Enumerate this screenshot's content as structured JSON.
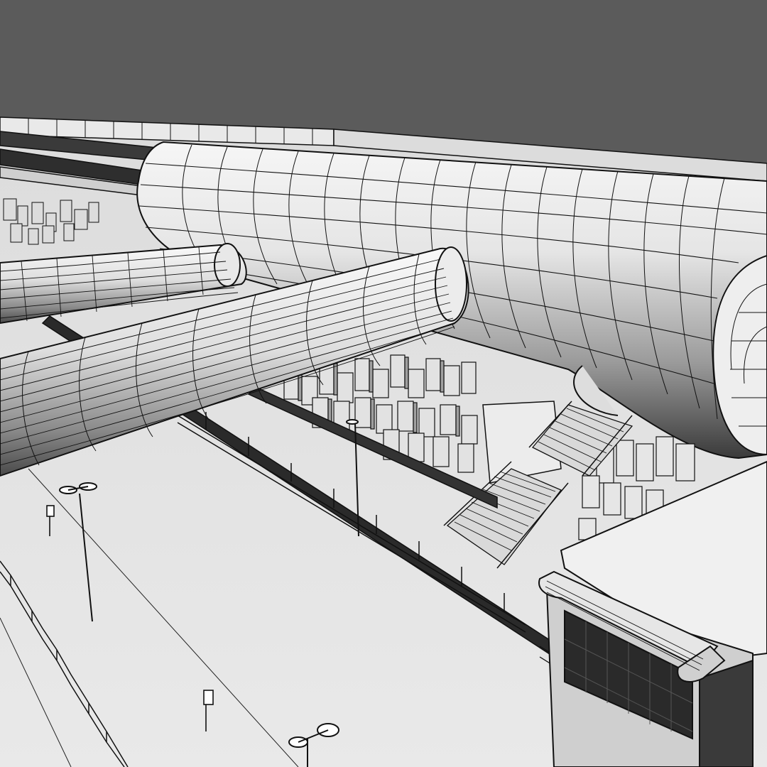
{
  "scene": {
    "description_visible_text": "",
    "palette": {
      "sky": "#5b5b5b",
      "ground": "#e6e6e6",
      "ground_light": "#f0f0f0",
      "line": "#111111",
      "tube_light": "#f4f4f4",
      "tube_mid": "#bdbdbd",
      "tube_dark": "#6f6f6f",
      "glass_dark": "#2b2b2b",
      "block_light": "#dcdcdc",
      "block_mid": "#a9a9a9"
    },
    "objects": [
      "sky-backdrop",
      "distant-rail-viaduct",
      "large-main-tube",
      "small-left-tube",
      "small-front-tube",
      "crowd-blocks",
      "stairs",
      "ticket-building",
      "lamp-post",
      "fence",
      "ground-plaza"
    ]
  }
}
